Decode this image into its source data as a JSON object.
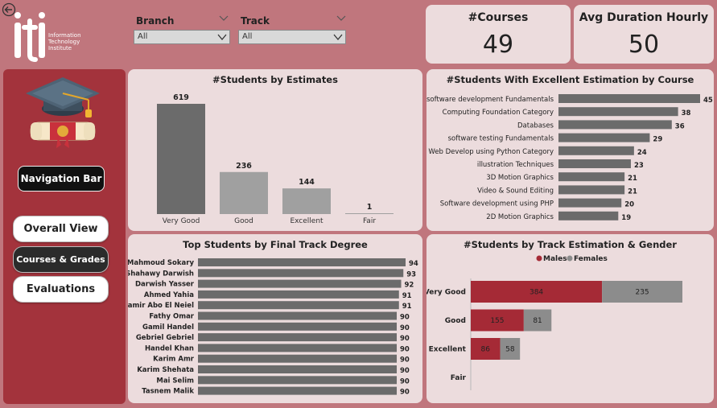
{
  "logo": {
    "letters": "iTi",
    "lines": [
      "Information",
      "Technology",
      "Institute"
    ]
  },
  "filters": [
    {
      "label": "Branch",
      "value": "All"
    },
    {
      "label": "Track",
      "value": "All"
    }
  ],
  "kpis": [
    {
      "label": "#Courses",
      "value": "49"
    },
    {
      "label": "Avg Duration Hourly",
      "value": "50"
    }
  ],
  "nav": {
    "title": "Navigation Bar",
    "buttons": [
      {
        "label": "Overall View",
        "active": false
      },
      {
        "label": "Courses & Grades",
        "active": true
      },
      {
        "label": "Evaluations",
        "active": false
      }
    ]
  },
  "colors": {
    "background": "#c0767d",
    "panel": "#ecdcdd",
    "nav_panel": "#a3333c",
    "male": "#a52a36",
    "female": "#8c8c8c",
    "bar_dark": "#6b6b6b",
    "bar_light": "#a0a0a0"
  },
  "chart_data": [
    {
      "id": "estimates",
      "type": "bar",
      "title": "#Students by Estimates",
      "categories": [
        "Very Good",
        "Good",
        "Excellent",
        "Fair"
      ],
      "values": [
        619,
        236,
        144,
        1
      ]
    },
    {
      "id": "excellent_by_course",
      "type": "bar",
      "orientation": "horizontal",
      "title": "#Students With Excellent Estimation by Course",
      "categories": [
        "software development Fundamentals",
        "Computing Foundation Category",
        "Databases",
        "software testing Fundamentals",
        "Web Develop using Python Category",
        "illustration Techniques",
        "3D Motion Graphics",
        "Video & Sound Editing",
        "Software development using PHP",
        "2D Motion Graphics"
      ],
      "values": [
        45,
        38,
        36,
        29,
        24,
        23,
        21,
        21,
        20,
        19
      ]
    },
    {
      "id": "top_students",
      "type": "bar",
      "orientation": "horizontal",
      "title": "Top Students by Final Track Degree",
      "categories": [
        "Mahmoud Sokary",
        "Shahawy Darwish",
        "Darwish Yasser",
        "Ahmed Yahia",
        "Samir Abo El Neiel",
        "Fathy Omar",
        "Gamil Handel",
        "Gebriel Gebriel",
        "Handel Khan",
        "Karim Amr",
        "Karim Shehata",
        "Mai Selim",
        "Tasnem Malik"
      ],
      "values": [
        94,
        93,
        92,
        91,
        91,
        90,
        90,
        90,
        90,
        90,
        90,
        90,
        90
      ]
    },
    {
      "id": "track_gender",
      "type": "bar",
      "orientation": "horizontal",
      "stacked": true,
      "title": "#Students by Track Estimation & Gender",
      "legend": "top",
      "categories": [
        "Very Good",
        "Good",
        "Excellent",
        "Fair"
      ],
      "series": [
        {
          "name": "Males",
          "values": [
            384,
            155,
            86,
            0
          ]
        },
        {
          "name": "Females",
          "values": [
            235,
            81,
            58,
            0
          ]
        }
      ]
    }
  ]
}
